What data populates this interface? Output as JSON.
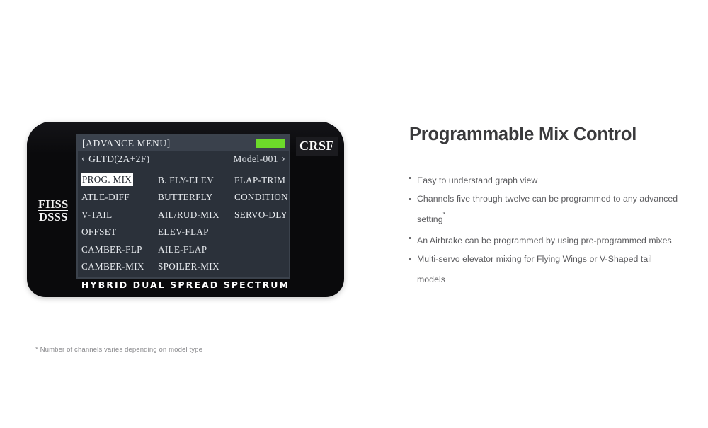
{
  "device": {
    "crsf_badge": "CRSF",
    "protocol_badge": {
      "line1": "FHSS",
      "line2": "DSSS"
    },
    "spectrum_wordmark": "HYBRID DUAL SPREAD SPECTRUM",
    "screen": {
      "title": "[ADVANCE MENU]",
      "battery_color": "#6ddb2a",
      "left_arrow": "‹",
      "right_arrow": "›",
      "model_type": "GLTD(2A+2F)",
      "model_name": "Model-001",
      "selected_item": "PROG. MIX",
      "menu_rows": [
        [
          "PROG. MIX",
          "B. FLY-ELEV",
          "FLAP-TRIM"
        ],
        [
          "ATLE-DIFF",
          "BUTTERFLY",
          "CONDITION"
        ],
        [
          "V-TAIL",
          "AIL/RUD-MIX",
          "SERVO-DLY"
        ],
        [
          "OFFSET",
          "ELEV-FLAP",
          ""
        ],
        [
          "CAMBER-FLP",
          "AILE-FLAP",
          ""
        ],
        [
          "CAMBER-MIX",
          "SPOILER-MIX",
          ""
        ]
      ]
    }
  },
  "content": {
    "headline": "Programmable Mix Control",
    "bullets": [
      {
        "text": "Easy to understand graph view",
        "footnote_marker": ""
      },
      {
        "text": "Channels five through twelve can be programmed to any advanced setting",
        "footnote_marker": "*"
      },
      {
        "text": "An Airbrake can be programmed by using pre-programmed mixes",
        "footnote_marker": ""
      },
      {
        "text": "Multi-servo elevator mixing for Flying Wings or V-Shaped tail models",
        "footnote_marker": ""
      }
    ]
  },
  "footnote": "* Number of channels varies depending on model type",
  "colors": {
    "page_background": "#ffffff",
    "device_body": "#0a0a0c",
    "lcd_background": "#2b313a",
    "lcd_header": "#3a414c",
    "lcd_text": "#e7eaee",
    "battery_green": "#6ddb2a",
    "headline_text": "#3a3a3c",
    "body_text": "#5b5b5e",
    "footnote_text": "#8a8a8d"
  }
}
